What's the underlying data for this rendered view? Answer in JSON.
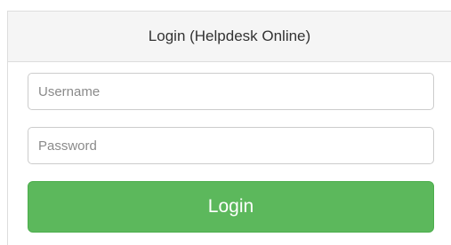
{
  "panel": {
    "title": "Login (Helpdesk Online)"
  },
  "form": {
    "username_placeholder": "Username",
    "username_value": "",
    "password_placeholder": "Password",
    "password_value": "",
    "login_label": "Login"
  },
  "colors": {
    "heading_background": "#f5f5f5",
    "border": "#dddddd",
    "button_background": "#5cb85c",
    "button_text": "#ffffff"
  }
}
